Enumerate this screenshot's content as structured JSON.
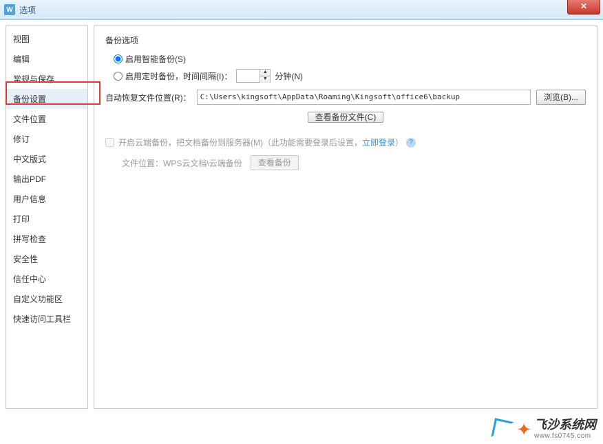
{
  "window": {
    "title": "选项",
    "icon_letter": "W"
  },
  "sidebar": {
    "items": [
      {
        "label": "视图"
      },
      {
        "label": "编辑"
      },
      {
        "label": "常规与保存"
      },
      {
        "label": "备份设置"
      },
      {
        "label": "文件位置"
      },
      {
        "label": "修订"
      },
      {
        "label": "中文版式"
      },
      {
        "label": "输出PDF"
      },
      {
        "label": "用户信息"
      },
      {
        "label": "打印"
      },
      {
        "label": "拼写检查"
      },
      {
        "label": "安全性"
      },
      {
        "label": "信任中心"
      },
      {
        "label": "自定义功能区"
      },
      {
        "label": "快速访问工具栏"
      }
    ],
    "selected_index": 3
  },
  "main": {
    "section_title": "备份选项",
    "smart_backup_label": "启用智能备份(S)",
    "timed_backup_label": "启用定时备份，时间间隔(I)：",
    "interval_value": "",
    "interval_unit": "分钟(N)",
    "recovery_path_label": "自动恢复文件位置(R)：",
    "recovery_path_value": "C:\\Users\\kingsoft\\AppData\\Roaming\\Kingsoft\\office6\\backup",
    "browse_btn": "浏览(B)...",
    "view_backup_btn": "查看备份文件(C)",
    "cloud_backup_label": "开启云端备份，把文档备份到服务器(M)（此功能需要登录后设置，",
    "login_link": "立即登录",
    "cloud_backup_tail": "）",
    "file_location_label": "文件位置：",
    "file_location_value": "WPS云文档\\云端备份",
    "view_cloud_btn": "查看备份"
  },
  "watermark": {
    "main": "飞沙系统网",
    "sub": "www.fs0745.com"
  }
}
